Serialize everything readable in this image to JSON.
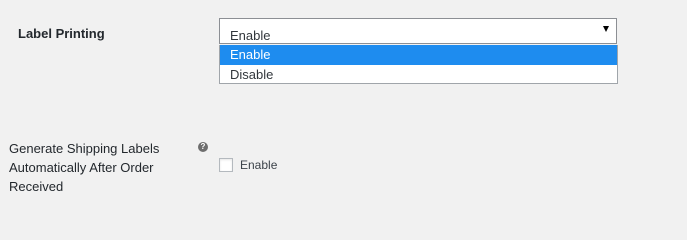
{
  "label_printing": {
    "label": "Label Printing",
    "select": {
      "value": "Enable",
      "options": [
        "Enable",
        "Disable"
      ],
      "highlighted_option": "Enable"
    }
  },
  "auto_labels": {
    "label": "Generate Shipping Labels Automatically After Order Received",
    "help_icon": "question-mark-icon",
    "checkbox": {
      "checked": false,
      "label": "Enable"
    }
  },
  "colors": {
    "highlight": "#1e8cef",
    "background": "#f1f1f1"
  }
}
